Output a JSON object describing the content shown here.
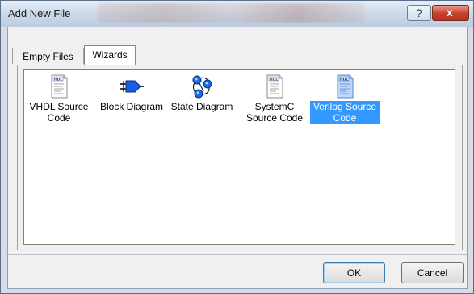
{
  "window": {
    "title": "Add New File",
    "help_glyph": "?",
    "close_glyph": "x"
  },
  "tabs": [
    {
      "label": "Empty Files",
      "selected": false
    },
    {
      "label": "Wizards",
      "selected": true
    }
  ],
  "items": [
    {
      "label": "VHDL Source Code",
      "icon": "hdl-file-icon",
      "selected": false
    },
    {
      "label": "Block Diagram",
      "icon": "block-diagram-icon",
      "selected": false
    },
    {
      "label": "State Diagram",
      "icon": "state-diagram-icon",
      "selected": false
    },
    {
      "label": "SystemC Source Code",
      "icon": "hdl-file-icon",
      "selected": false
    },
    {
      "label": "Verilog Source Code",
      "icon": "hdl-file-icon",
      "selected": true
    }
  ],
  "icon_badge": "HDL",
  "buttons": {
    "ok": "OK",
    "cancel": "Cancel"
  },
  "colors": {
    "selection": "#3399ff",
    "close_button": "#c9432b"
  }
}
